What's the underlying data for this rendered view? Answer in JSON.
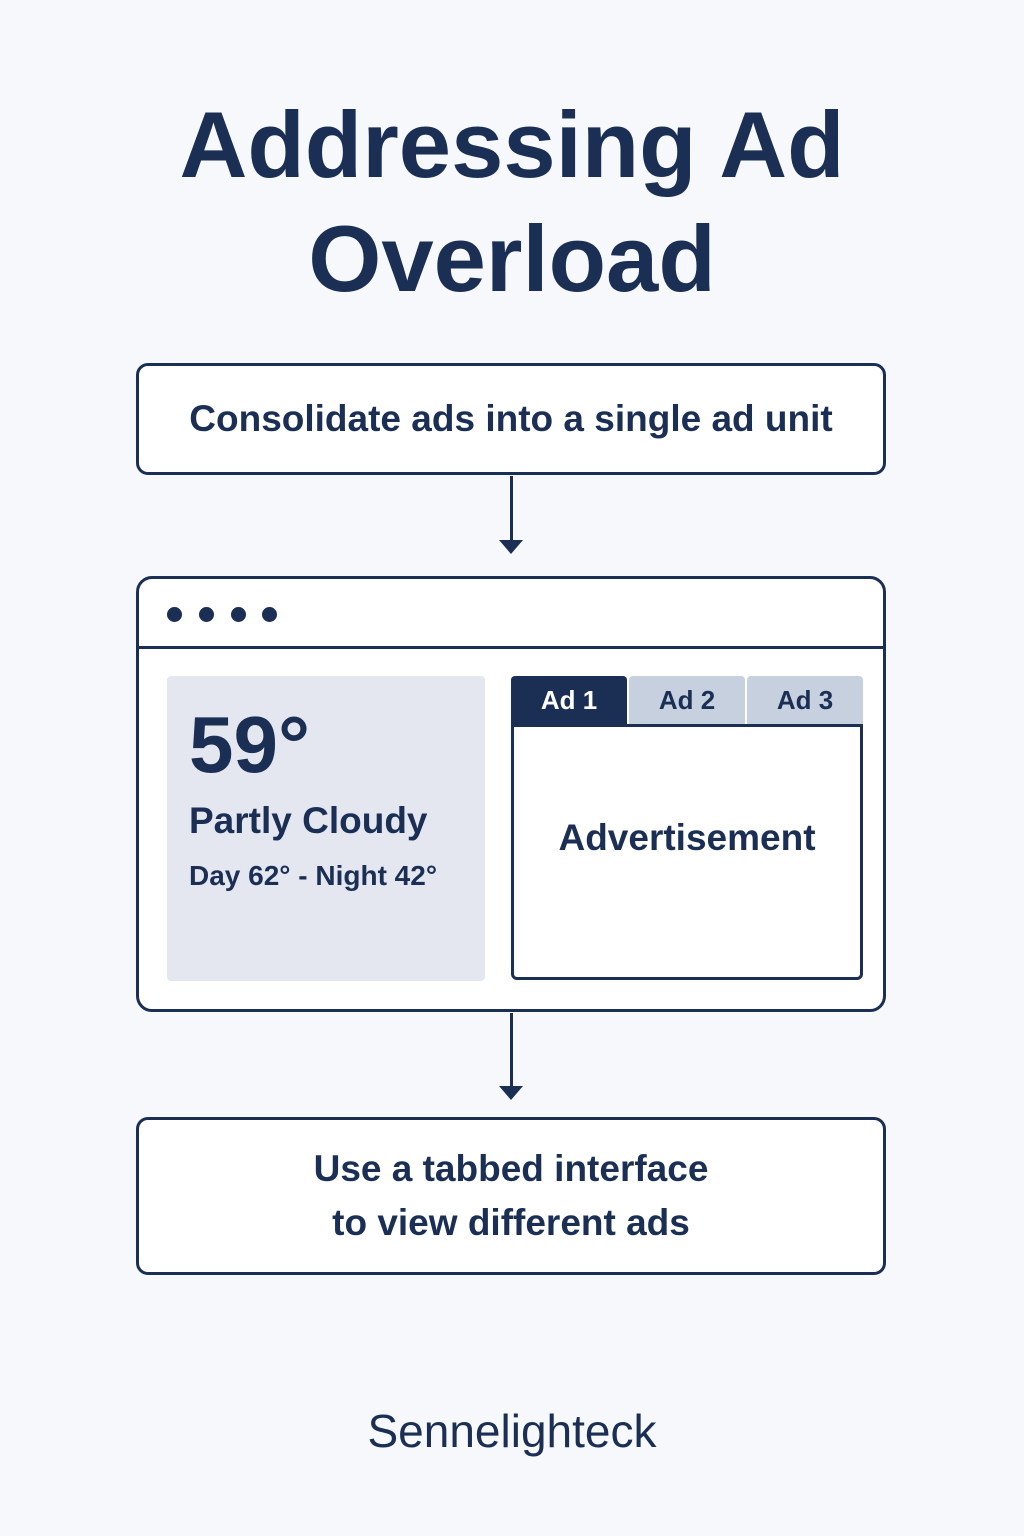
{
  "title": {
    "line1": "Addressing Ad",
    "line2": "Overload"
  },
  "step1": {
    "text": "Consolidate ads into a single ad unit"
  },
  "browser": {
    "weather": {
      "temperature": "59°",
      "condition": "Partly Cloudy",
      "day_night": "Day 62° - Night 42°"
    },
    "ad_unit": {
      "tabs": [
        {
          "label": "Ad 1",
          "active": true
        },
        {
          "label": "Ad 2",
          "active": false
        },
        {
          "label": "Ad 3",
          "active": false
        }
      ],
      "content_label": "Advertisement"
    }
  },
  "step2": {
    "line1": "Use a tabbed interface",
    "line2": "to view different ads"
  },
  "brand": "Sennelighteck",
  "colors": {
    "primary": "#1b2f55",
    "tab_inactive": "#c7d0de",
    "weather_bg": "#e4e7ef",
    "background": "#f6f8fb"
  }
}
